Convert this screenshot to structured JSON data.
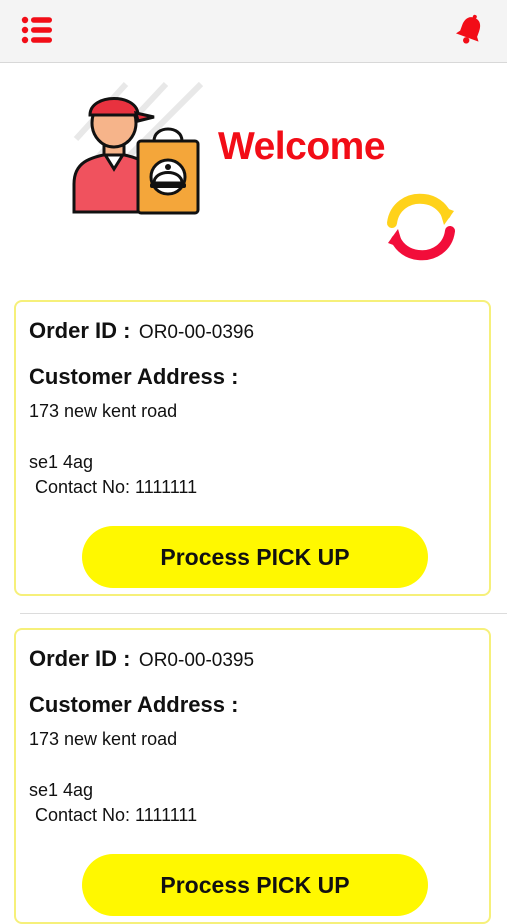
{
  "header": {
    "menu_icon": "list-menu-icon",
    "bell_icon": "bell-icon",
    "accent_color": "#f20d17"
  },
  "hero": {
    "welcome_text": "Welcome",
    "illustration_icon": "delivery-person-icon",
    "refresh_icon": "refresh-icon"
  },
  "orders": [
    {
      "id_label": "Order ID :",
      "id_value": "OR0-00-0396",
      "address_label": "Customer Address :",
      "address_line1": "173 new kent road",
      "address_line2": "se1 4ag",
      "contact": "Contact No: 1111111",
      "button_label": "Process PICK UP"
    },
    {
      "id_label": "Order ID :",
      "id_value": "OR0-00-0395",
      "address_label": "Customer Address :",
      "address_line1": "173 new kent road",
      "address_line2": "se1 4ag",
      "contact": "Contact No: 1111111",
      "button_label": "Process PICK UP"
    }
  ],
  "colors": {
    "button_yellow": "#fff800",
    "card_border": "#f6f07a"
  }
}
